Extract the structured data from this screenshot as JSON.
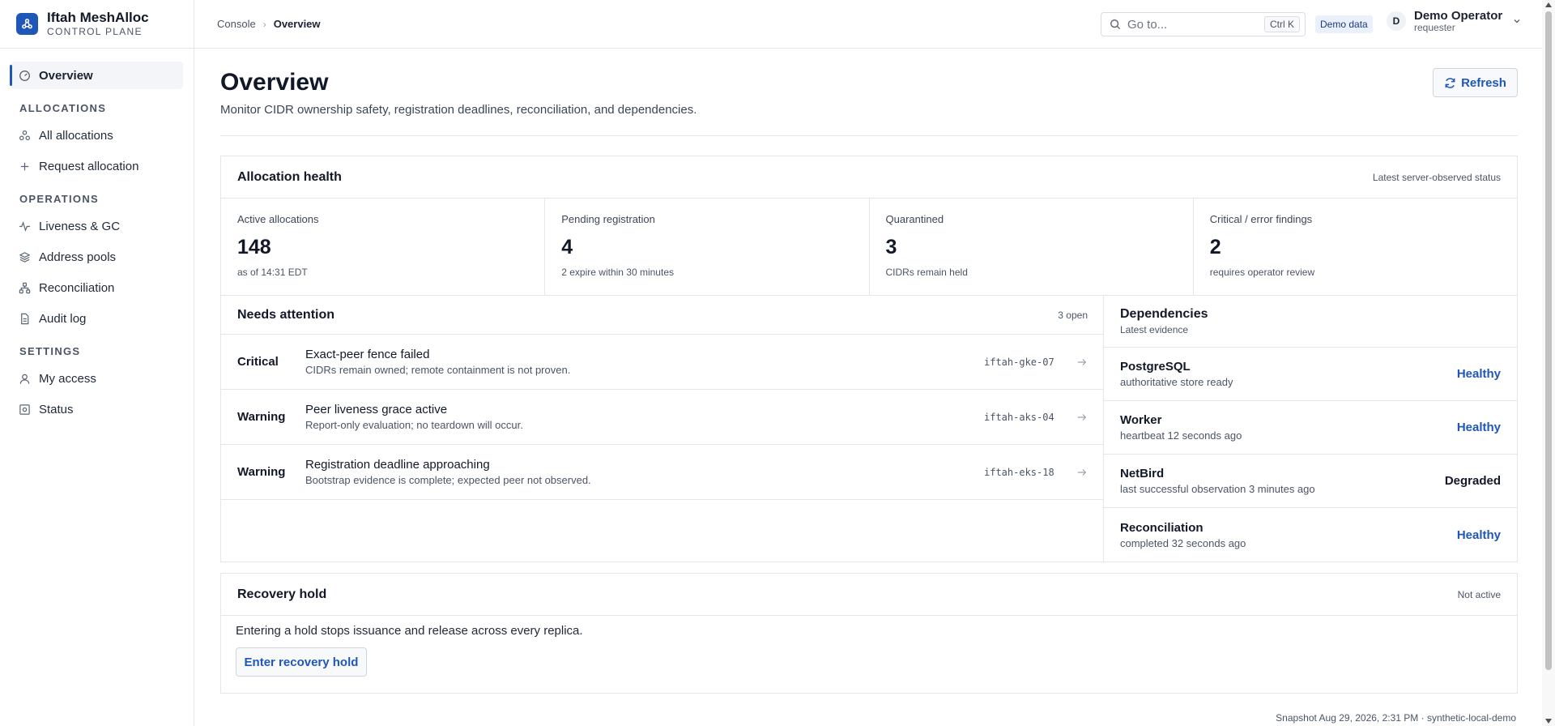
{
  "brand": {
    "name": "Iftah MeshAlloc",
    "subtitle": "CONTROL PLANE"
  },
  "sidebar": {
    "overview": "Overview",
    "sections": {
      "allocations": "ALLOCATIONS",
      "operations": "OPERATIONS",
      "settings": "SETTINGS"
    },
    "items": {
      "all_allocations": "All allocations",
      "request_allocation": "Request allocation",
      "liveness": "Liveness & GC",
      "address_pools": "Address pools",
      "reconciliation": "Reconciliation",
      "audit_log": "Audit log",
      "my_access": "My access",
      "status": "Status"
    }
  },
  "topbar": {
    "breadcrumb": [
      "Console",
      "Overview"
    ],
    "search_placeholder": "Go to...",
    "search_shortcut": "Ctrl K",
    "demo_badge": "Demo data",
    "user": {
      "initial": "D",
      "name": "Demo Operator",
      "role": "requester"
    }
  },
  "header": {
    "title": "Overview",
    "description": "Monitor CIDR ownership safety, registration deadlines, reconciliation, and dependencies.",
    "refresh_label": "Refresh"
  },
  "health": {
    "title": "Allocation health",
    "meta": "Latest server-observed status",
    "metrics": [
      {
        "label": "Active allocations",
        "value": "148",
        "note": "as of 14:31 EDT"
      },
      {
        "label": "Pending registration",
        "value": "4",
        "note": "2 expire within 30 minutes"
      },
      {
        "label": "Quarantined",
        "value": "3",
        "note": "CIDRs remain held"
      },
      {
        "label": "Critical / error findings",
        "value": "2",
        "note": "requires operator review"
      }
    ]
  },
  "attention": {
    "title": "Needs attention",
    "count": "3 open",
    "items": [
      {
        "severity": "Critical",
        "title": "Exact-peer fence failed",
        "desc": "CIDRs remain owned; remote containment is not proven.",
        "target": "iftah-gke-07"
      },
      {
        "severity": "Warning",
        "title": "Peer liveness grace active",
        "desc": "Report-only evaluation; no teardown will occur.",
        "target": "iftah-aks-04"
      },
      {
        "severity": "Warning",
        "title": "Registration deadline approaching",
        "desc": "Bootstrap evidence is complete; expected peer not observed.",
        "target": "iftah-eks-18"
      }
    ]
  },
  "dependencies": {
    "title": "Dependencies",
    "subtitle": "Latest evidence",
    "items": [
      {
        "name": "PostgreSQL",
        "note": "authoritative store ready",
        "status": "Healthy",
        "color": "#1f57b8"
      },
      {
        "name": "Worker",
        "note": "heartbeat 12 seconds ago",
        "status": "Healthy",
        "color": "#1f57b8"
      },
      {
        "name": "NetBird",
        "note": "last successful observation 3 minutes ago",
        "status": "Degraded",
        "color": "#111827"
      },
      {
        "name": "Reconciliation",
        "note": "completed 32 seconds ago",
        "status": "Healthy",
        "color": "#1f57b8"
      }
    ]
  },
  "recovery": {
    "title": "Recovery hold",
    "meta": "Not active",
    "text": "Entering a hold stops issuance and release across every replica.",
    "button": "Enter recovery hold"
  },
  "footer": {
    "snapshot": "Snapshot Aug 29, 2026, 2:31 PM · synthetic-local-demo"
  },
  "colors": {
    "accent": "#1f57b8",
    "border": "#e3e6ea",
    "badge_bg": "#eaf1fc"
  }
}
